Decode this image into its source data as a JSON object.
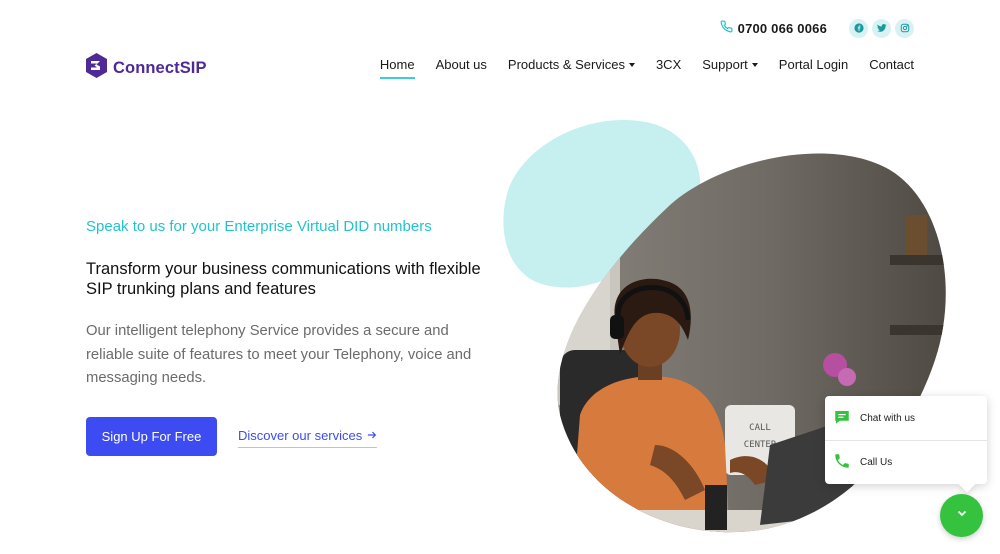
{
  "topbar": {
    "phone": "0700 066 0066",
    "socials": [
      {
        "icon": "facebook-icon"
      },
      {
        "icon": "twitter-icon"
      },
      {
        "icon": "instagram-icon"
      }
    ]
  },
  "brand": {
    "name": "ConnectSIP",
    "color": "#4f2a95"
  },
  "nav": {
    "items": [
      {
        "label": "Home",
        "active": true
      },
      {
        "label": "About us"
      },
      {
        "label": "Products & Services",
        "dropdown": true
      },
      {
        "label": "3CX"
      },
      {
        "label": "Support",
        "dropdown": true
      },
      {
        "label": "Portal Login"
      },
      {
        "label": "Contact"
      }
    ]
  },
  "hero": {
    "eyebrow": "Speak to us for your Enterprise Virtual DID numbers",
    "headline": "Transform your business communications with flexible SIP trunking plans and features",
    "description": "Our intelligent telephony Service provides a secure and reliable suite of features to meet your Telephony, voice and messaging needs.",
    "cta_label": "Sign Up For Free",
    "link_label": "Discover our services",
    "image_sign": "CALL CENTER"
  },
  "chat_widget": {
    "chat_label": "Chat with us",
    "call_label": "Call Us"
  },
  "colors": {
    "accent_teal": "#22c4cb",
    "primary_blue": "#3c4cf2",
    "widget_green": "#35c23f"
  }
}
